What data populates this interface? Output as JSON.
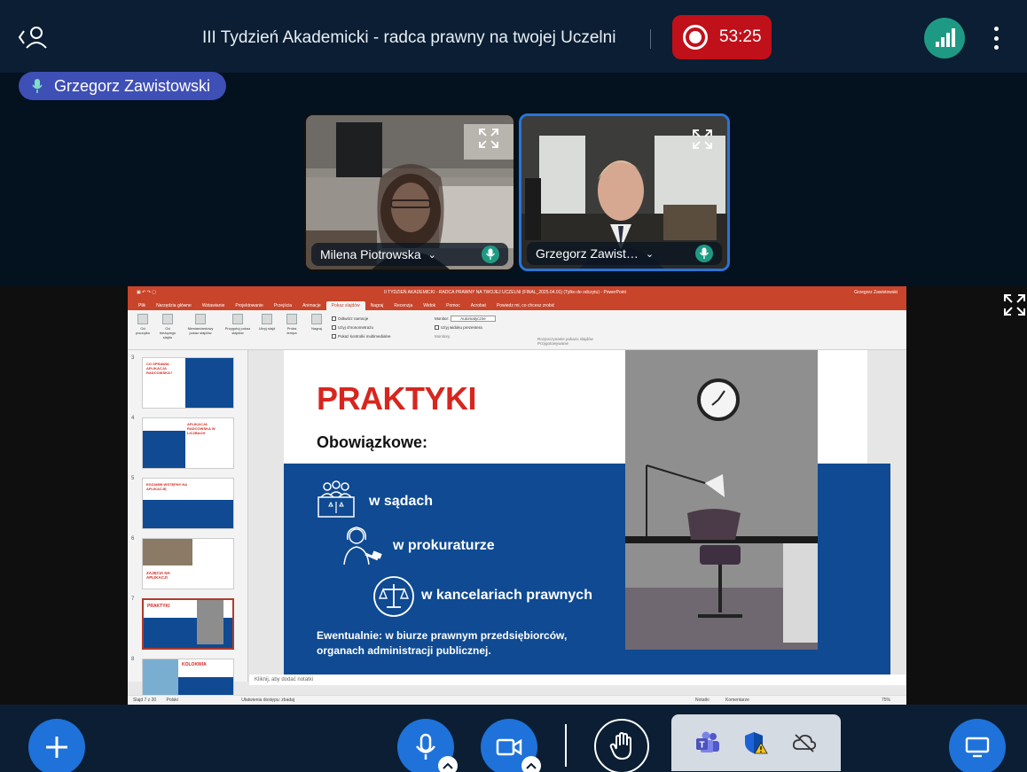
{
  "header": {
    "title": "III Tydzień Akademicki - radca prawny na twojej Uczelni",
    "recording_time": "53:25"
  },
  "talker": {
    "name": "Grzegorz Zawistowski"
  },
  "videos": [
    {
      "name": "Milena Piotrowska",
      "chevron": "⌄"
    },
    {
      "name": "Grzegorz Zawist…",
      "chevron": "⌄"
    }
  ],
  "presentation": {
    "app_title": "II TYDZIEŃ AKADEMICKI - RADCA PRAWNY NA TWOJEJ UCZELNI (FINAL_2025.04.01) (Tylko do odczytu) - PowerPoint",
    "user_name": "Grzegorz Zawistowski",
    "tabs": [
      "Plik",
      "Narzędzia główne",
      "Wstawianie",
      "Projektowanie",
      "Przejścia",
      "Animacje",
      "Pokaz slajdów",
      "Nagraj",
      "Recenzja",
      "Widok",
      "Pomoc",
      "Acrobat",
      "Powiedz mi, co chcesz zrobić"
    ],
    "ribbon": {
      "buttons": [
        "Od początku",
        "Od bieżącego slajdu",
        "Niestandardowy pokaz slajdów",
        "Przygotuj pokaz slajdów",
        "Ukryj slajd",
        "Próba tempa",
        "Nagraj"
      ],
      "checks": [
        "Odtwórz narracje",
        "Użyj chronometrażu",
        "Pokaż kontrolki multimedialne"
      ],
      "monitor_label": "Monitor:",
      "monitor_value": "Automatyczne",
      "presenter_check": "Użyj widoku prezentera",
      "group_1": "Rozpoczynanie pokazu slajdów",
      "group_2": "Przygotowywanie",
      "group_3": "Monitory"
    },
    "thumbs": [
      {
        "num": "3",
        "title": "CO SPRAWIA APLIKACJA RADCOWSKA?"
      },
      {
        "num": "4",
        "title": "APLIKACJA RADCOWSKA W LICZBACH"
      },
      {
        "num": "5",
        "title": "EGZAMIN WSTĘPNY NA APLIKACJĘ"
      },
      {
        "num": "6",
        "title": "ZAJĘCIA NA APLIKACJI"
      },
      {
        "num": "7",
        "title": "PRAKTYKI"
      },
      {
        "num": "8",
        "title": "KOLOKWIA"
      }
    ],
    "notes_placeholder": "Kliknij, aby dodać notatki",
    "status_left": "Slajd 7 z 20",
    "status_lang": "Polski",
    "status_access": "Ułatwienia dostępu: zbadaj",
    "status_notes": "Notatki",
    "status_comments": "Komentarze",
    "zoom": "75%",
    "slide": {
      "heading": "PRAKTYKI",
      "subheading": "Obowiązkowe:",
      "items": [
        "w sądach",
        "w prokuraturze",
        "w kancelariach prawnych"
      ],
      "note": "Ewentualnie: w biurze prawnym przedsiębiorców, organach administracji publicznej."
    }
  },
  "colors": {
    "record": "#c0101a",
    "accent": "#1e72d9",
    "talker": "#3e4fb5",
    "slide_blue": "#0f4a92",
    "slide_red": "#d7261e"
  }
}
